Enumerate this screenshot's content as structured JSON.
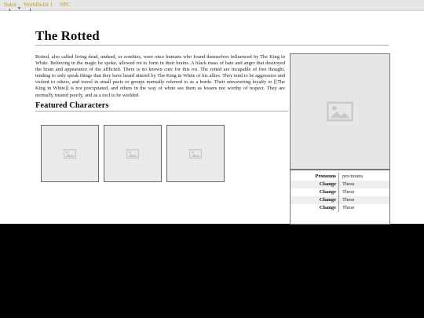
{
  "nav": {
    "links": [
      "Index",
      "Worldbuild 1",
      "NPC"
    ]
  },
  "page": {
    "title": "The Rotted",
    "body": "Rotted, also called living dead, undead, or zombies, were once humans who found themselves influenced by The King in White. Believing in the magic he spoke, allowed rot to form in their brains. A black mass of hate and anger that destroyed the brain and appearance of the afflicted. There is no known cure for this rot. The rotted are incapable of free thought, tending to only speak things that they have heard uttered by The King in White or his allies. They tend to be aggressive and violent to others, and travel in small pacts or groups normally referred to as a horde. Their unwavering loyalty to [[The King in White]] is not precipitated, and others in the way of white see them as lessers not worthy of respect. They are normally treated poorly, and as a tool to be wielded.",
    "featured_title": "Featured Characters"
  },
  "infobox": {
    "rows": [
      {
        "key": "Pronouns",
        "value": "pro/nouns"
      },
      {
        "key": "Change",
        "value": "These"
      },
      {
        "key": "Change",
        "value": "These"
      },
      {
        "key": "Change",
        "value": "These"
      },
      {
        "key": "Change",
        "value": "These"
      }
    ]
  },
  "icons": {
    "placeholder": "image-placeholder-icon",
    "dropdown": "chevron-down-icon"
  },
  "colors": {
    "nav_link": "#c79a1d",
    "nav_bg": "#e6e6e6",
    "placeholder_bg": "#e6e6e6",
    "placeholder_icon": "#c8c8c8"
  }
}
